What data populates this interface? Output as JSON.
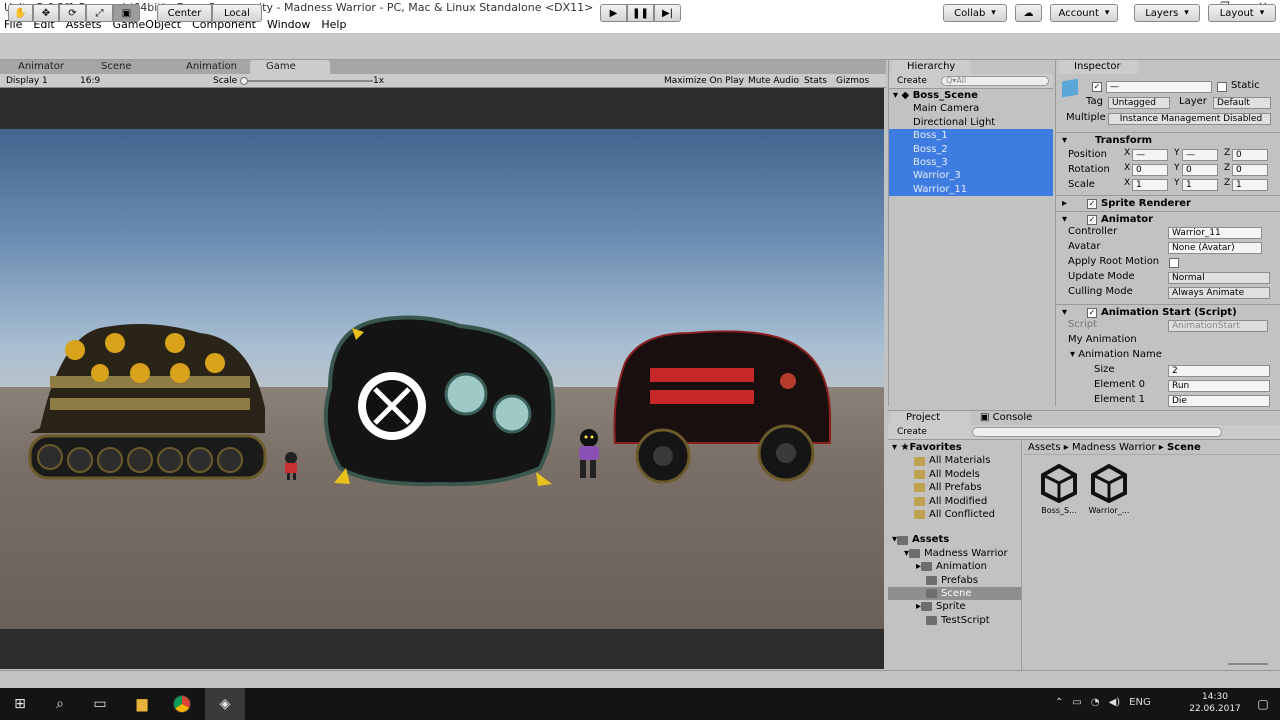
{
  "window": {
    "title": "Unity 5.6.2f1 Personal (64bit) - Boss_Scene.unity - Madness Warrior - PC, Mac & Linux Standalone <DX11>"
  },
  "menu": [
    "File",
    "Edit",
    "Assets",
    "GameObject",
    "Component",
    "Window",
    "Help"
  ],
  "toolbar": {
    "pivot": "Center",
    "space": "Local",
    "collab": "Collab",
    "account": "Account",
    "layers": "Layers",
    "layout": "Layout"
  },
  "tabs": {
    "animator": "Animator",
    "scene": "Scene",
    "animation": "Animation",
    "game": "Game"
  },
  "gamebar": {
    "display": "Display 1",
    "aspect": "16:9",
    "scale_label": "Scale",
    "scale_value": "1x",
    "maximize": "Maximize On Play",
    "mute": "Mute Audio",
    "stats": "Stats",
    "gizmos": "Gizmos"
  },
  "hierarchy": {
    "tab": "Hierarchy",
    "create": "Create",
    "search_placeholder": "Q▾All",
    "scene": "Boss_Scene",
    "items": [
      {
        "label": "Main Camera",
        "selected": false
      },
      {
        "label": "Directional Light",
        "selected": false
      },
      {
        "label": "Boss_1",
        "selected": true
      },
      {
        "label": "Boss_2",
        "selected": true
      },
      {
        "label": "Boss_3",
        "selected": true
      },
      {
        "label": "Warrior_3",
        "selected": true
      },
      {
        "label": "Warrior_11",
        "selected": true
      }
    ]
  },
  "inspector": {
    "tab": "Inspector",
    "name_value": "—",
    "static_label": "Static",
    "tag_label": "Tag",
    "tag_value": "Untagged",
    "layer_label": "Layer",
    "layer_value": "Default",
    "multiple_label": "Multiple",
    "multiple_value": "Instance Management Disabled",
    "transform": {
      "title": "Transform",
      "position": "Position",
      "rotation": "Rotation",
      "scale": "Scale",
      "pos": [
        "—",
        "—",
        "0"
      ],
      "rot": [
        "0",
        "0",
        "0"
      ],
      "scl": [
        "1",
        "1",
        "1"
      ]
    },
    "sprite_renderer": "Sprite Renderer",
    "animator": {
      "title": "Animator",
      "controller_label": "Controller",
      "controller_value": "Warrior_11",
      "avatar_label": "Avatar",
      "avatar_value": "None (Avatar)",
      "root_motion": "Apply Root Motion",
      "update_label": "Update Mode",
      "update_value": "Normal",
      "culling_label": "Culling Mode",
      "culling_value": "Always Animate"
    },
    "script_comp": {
      "title": "Animation Start (Script)",
      "script_label": "Script",
      "script_value": "AnimationStart",
      "my_anim": "My Animation",
      "anim_name": "Animation Name",
      "size_label": "Size",
      "size_value": "2",
      "el0_label": "Element 0",
      "el0_value": "Run",
      "el1_label": "Element 1",
      "el1_value": "Die"
    }
  },
  "project": {
    "tab": "Project",
    "console": "Console",
    "create": "Create",
    "favorites_title": "Favorites",
    "favorites": [
      "All Materials",
      "All Models",
      "All Prefabs",
      "All Modified",
      "All Conflicted"
    ],
    "assets_title": "Assets",
    "madness": "Madness Warrior",
    "folders": [
      "Animation",
      "Prefabs",
      "Scene",
      "Sprite",
      "TestScript"
    ],
    "breadcrumb": [
      "Assets",
      "Madness Warrior",
      "Scene"
    ],
    "files": [
      "Boss_S...",
      "Warrior_..."
    ]
  },
  "taskbar": {
    "lang": "ENG",
    "time": "14:30",
    "date": "22.06.2017"
  }
}
